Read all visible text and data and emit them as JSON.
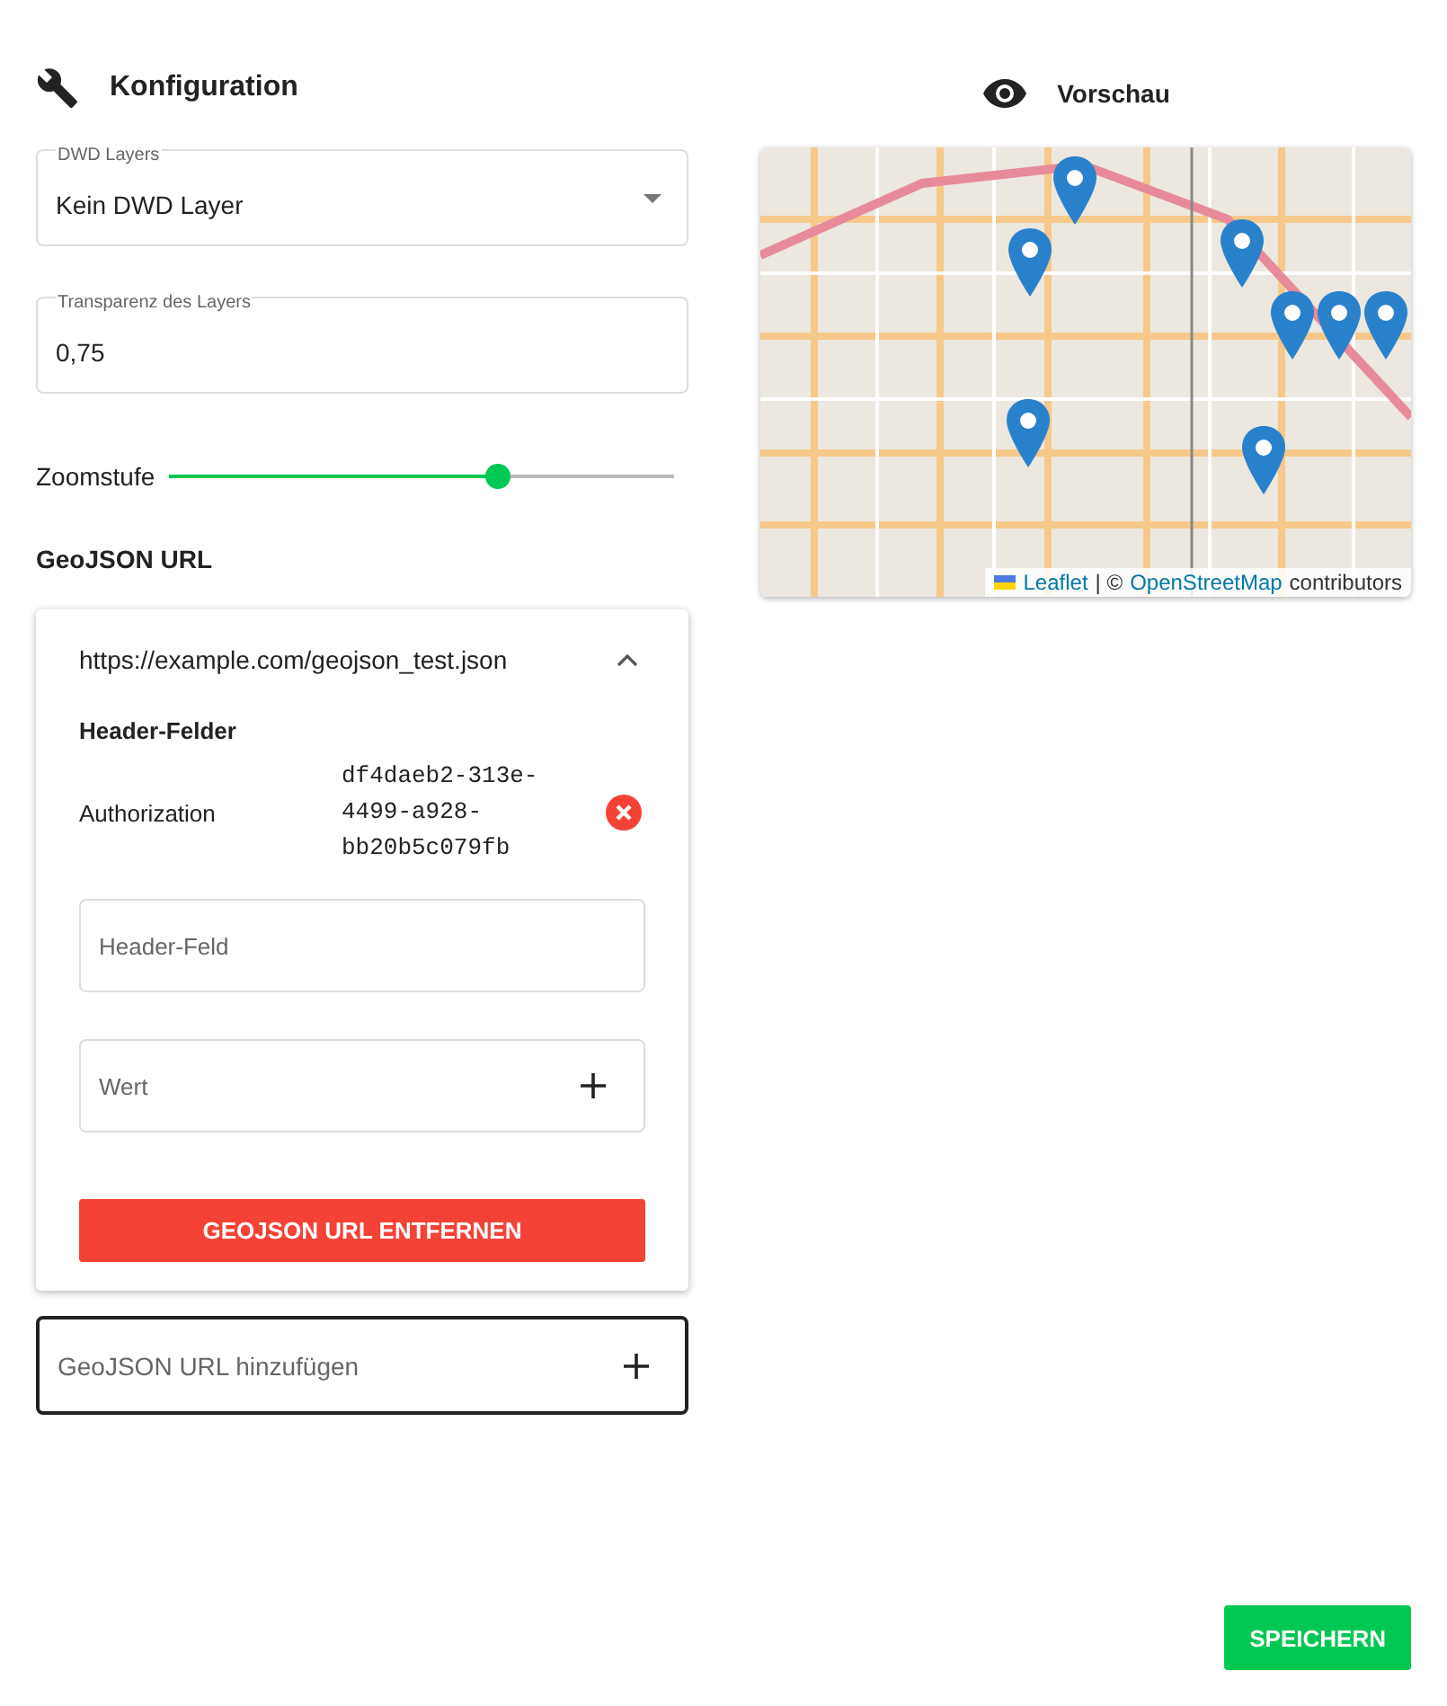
{
  "config": {
    "title": "Konfiguration",
    "dwd_select": {
      "label": "DWD Layers",
      "value": "Kein DWD Layer"
    },
    "transparency_field": {
      "label": "Transparenz des Layers",
      "value": "0,75"
    },
    "zoom_slider": {
      "label": "Zoomstufe",
      "level": 0.65
    },
    "geojson_heading": "GeoJSON URL",
    "geojson_urls": [
      {
        "url": "https://example.com/geojson_test.json",
        "expanded": true,
        "headers_title": "Header-Felder",
        "headers": [
          {
            "name": "Authorization",
            "value": "df4daeb2-313e-4499-a928-bb20b5c079fb"
          }
        ],
        "header_name_placeholder": "Header-Feld",
        "header_value_placeholder": "Wert",
        "remove_button": "GEOJSON URL ENTFERNEN"
      }
    ],
    "add_url_placeholder": "GeoJSON URL hinzufügen"
  },
  "preview": {
    "title": "Vorschau",
    "attribution": {
      "leaflet": "Leaflet",
      "separator": "| ©",
      "osm": "OpenStreetMap",
      "suffix": "contributors"
    }
  },
  "save_button": "SPEICHERN"
}
